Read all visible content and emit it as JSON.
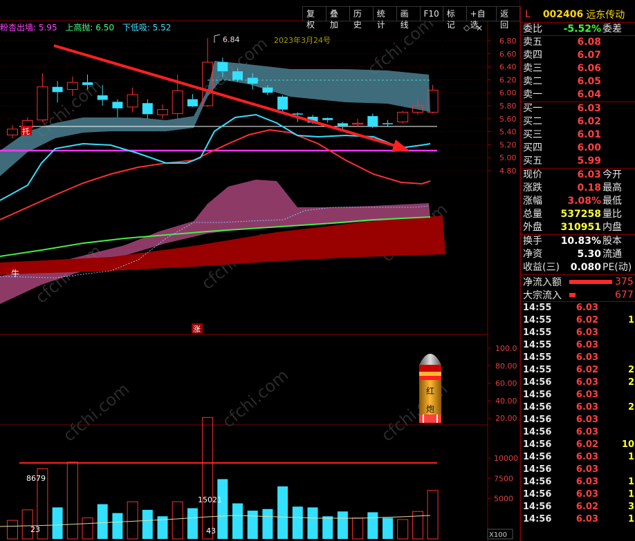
{
  "toolbar": {
    "buttons": [
      "复权",
      "叠加",
      "历史",
      "统计",
      "画线",
      "F10",
      "标记",
      "+自选",
      "返回"
    ]
  },
  "indicator_line": {
    "prefix": "粉杏出墙: 5.95",
    "up_label": "上高抛: 6.50",
    "down_label": "下低吸: 5.52"
  },
  "chart_labels": {
    "date_annotation": "2023年3月24号",
    "high_marker": "6.84",
    "tuo_badge": "托",
    "niu_label": "牛",
    "zhang_badge": "涨",
    "red_cannon_top": "红",
    "red_cannon_bottom": "炮",
    "vol_label_left": "8679",
    "vol_label_mid": "15021",
    "vol_label_low1": "23",
    "vol_label_low2": "43",
    "x100": "X100",
    "watermark": "cfchi.com"
  },
  "price_axis": [
    "6.80",
    "6.60",
    "6.40",
    "6.20",
    "6.00",
    "5.80",
    "5.60",
    "5.40",
    "5.20",
    "5.00",
    "4.80"
  ],
  "osc_axis": [
    "100.0",
    "80.00",
    "60.00",
    "40.00",
    "20.00"
  ],
  "vol_axis": [
    "10000",
    "7500",
    "5000"
  ],
  "stock": {
    "market": "L",
    "code": "002406",
    "name": "远东传动"
  },
  "order_ratio": {
    "label": "委比",
    "value": "-5.52%",
    "label2": "委差"
  },
  "asks": [
    {
      "label": "卖五",
      "price": "6.08"
    },
    {
      "label": "卖四",
      "price": "6.07"
    },
    {
      "label": "卖三",
      "price": "6.06"
    },
    {
      "label": "卖二",
      "price": "6.05"
    },
    {
      "label": "卖一",
      "price": "6.04"
    }
  ],
  "bids": [
    {
      "label": "买一",
      "price": "6.03"
    },
    {
      "label": "买二",
      "price": "6.02"
    },
    {
      "label": "买三",
      "price": "6.01"
    },
    {
      "label": "买四",
      "price": "6.00"
    },
    {
      "label": "买五",
      "price": "5.99"
    }
  ],
  "quote": [
    {
      "label": "现价",
      "value": "6.03",
      "label2": "今开",
      "color": "red"
    },
    {
      "label": "涨跌",
      "value": "0.18",
      "label2": "最高",
      "color": "red"
    },
    {
      "label": "涨幅",
      "value": "3.08%",
      "label2": "最低",
      "color": "red"
    },
    {
      "label": "总量",
      "value": "537258",
      "label2": "量比",
      "color": "yellow"
    },
    {
      "label": "外盘",
      "value": "310951",
      "label2": "内盘",
      "color": "yellow"
    }
  ],
  "fundamentals": [
    {
      "label": "换手",
      "value": "10.83%",
      "label2": "股本"
    },
    {
      "label": "净资",
      "value": "5.30",
      "label2": "流通"
    },
    {
      "label": "收益(三)",
      "value": "0.080",
      "label2": "PE(动)"
    }
  ],
  "flows": [
    {
      "label": "净流入额",
      "bar": 1.0,
      "value": "375"
    },
    {
      "label": "大宗流入",
      "bar": 0.15,
      "value": "677"
    }
  ],
  "ticks": [
    {
      "time": "14:55",
      "price": "6.03",
      "vol": "",
      "color": "red"
    },
    {
      "time": "14:55",
      "price": "6.02",
      "vol": "1",
      "color": "red"
    },
    {
      "time": "14:55",
      "price": "6.03",
      "vol": "",
      "color": "red"
    },
    {
      "time": "14:55",
      "price": "6.03",
      "vol": "",
      "color": "red"
    },
    {
      "time": "14:55",
      "price": "6.03",
      "vol": "",
      "color": "red"
    },
    {
      "time": "14:55",
      "price": "6.02",
      "vol": "2",
      "color": "red"
    },
    {
      "time": "14:56",
      "price": "6.03",
      "vol": "2",
      "color": "red"
    },
    {
      "time": "14:56",
      "price": "6.03",
      "vol": "",
      "color": "red"
    },
    {
      "time": "14:56",
      "price": "6.03",
      "vol": "2",
      "color": "red"
    },
    {
      "time": "14:56",
      "price": "6.03",
      "vol": "",
      "color": "red"
    },
    {
      "time": "14:56",
      "price": "6.03",
      "vol": "",
      "color": "red"
    },
    {
      "time": "14:56",
      "price": "6.02",
      "vol": "10",
      "color": "red"
    },
    {
      "time": "14:56",
      "price": "6.03",
      "vol": "1",
      "color": "red"
    },
    {
      "time": "14:56",
      "price": "6.03",
      "vol": "",
      "color": "red"
    },
    {
      "time": "14:56",
      "price": "6.03",
      "vol": "1",
      "color": "red"
    },
    {
      "time": "14:56",
      "price": "6.03",
      "vol": "1",
      "color": "red"
    },
    {
      "time": "14:56",
      "price": "6.02",
      "vol": "3",
      "color": "red"
    },
    {
      "time": "14:56",
      "price": "6.03",
      "vol": "1",
      "color": "red"
    }
  ],
  "chart_data": {
    "type": "candlestick",
    "ylim": [
      4.7,
      6.9
    ],
    "candles": [
      {
        "o": 5.35,
        "c": 5.44,
        "h": 5.5,
        "l": 5.3
      },
      {
        "o": 5.46,
        "c": 5.57,
        "h": 5.62,
        "l": 5.4
      },
      {
        "o": 5.58,
        "c": 6.09,
        "h": 6.3,
        "l": 5.55
      },
      {
        "o": 6.09,
        "c": 6.01,
        "h": 6.18,
        "l": 5.85
      },
      {
        "o": 6.05,
        "c": 6.16,
        "h": 6.25,
        "l": 5.95
      },
      {
        "o": 6.16,
        "c": 6.12,
        "h": 6.28,
        "l": 6.05
      },
      {
        "o": 5.96,
        "c": 5.89,
        "h": 6.12,
        "l": 5.8
      },
      {
        "o": 5.86,
        "c": 5.76,
        "h": 5.9,
        "l": 5.62
      },
      {
        "o": 5.78,
        "c": 5.97,
        "h": 6.08,
        "l": 5.7
      },
      {
        "o": 5.84,
        "c": 5.67,
        "h": 5.9,
        "l": 5.6
      },
      {
        "o": 5.66,
        "c": 5.74,
        "h": 5.82,
        "l": 5.6
      },
      {
        "o": 5.68,
        "c": 6.03,
        "h": 6.28,
        "l": 5.6
      },
      {
        "o": 5.9,
        "c": 5.79,
        "h": 5.98,
        "l": 5.78
      },
      {
        "o": 5.8,
        "c": 6.47,
        "h": 6.84,
        "l": 5.78
      },
      {
        "o": 6.47,
        "c": 6.33,
        "h": 6.54,
        "l": 6.24
      },
      {
        "o": 6.33,
        "c": 6.2,
        "h": 6.38,
        "l": 6.17
      },
      {
        "o": 6.23,
        "c": 6.14,
        "h": 6.3,
        "l": 6.05
      },
      {
        "o": 6.08,
        "c": 6.0,
        "h": 6.12,
        "l": 5.96
      },
      {
        "o": 5.94,
        "c": 5.74,
        "h": 5.96,
        "l": 5.7
      },
      {
        "o": 5.68,
        "c": 5.67,
        "h": 5.7,
        "l": 5.55
      },
      {
        "o": 5.63,
        "c": 5.54,
        "h": 5.66,
        "l": 5.52
      },
      {
        "o": 5.61,
        "c": 5.58,
        "h": 5.62,
        "l": 5.54
      },
      {
        "o": 5.53,
        "c": 5.49,
        "h": 5.55,
        "l": 5.44
      },
      {
        "o": 5.52,
        "c": 5.53,
        "h": 5.6,
        "l": 5.48
      },
      {
        "o": 5.64,
        "c": 5.48,
        "h": 5.68,
        "l": 5.46
      },
      {
        "o": 5.53,
        "c": 5.52,
        "h": 5.58,
        "l": 5.47
      },
      {
        "o": 5.55,
        "c": 5.7,
        "h": 5.72,
        "l": 5.53
      },
      {
        "o": 5.7,
        "c": 5.8,
        "h": 5.9,
        "l": 5.66
      },
      {
        "o": 5.7,
        "c": 6.04,
        "h": 6.12,
        "l": 5.68
      }
    ],
    "volumes": [
      {
        "v": 2300,
        "up": true
      },
      {
        "v": 3600,
        "up": true
      },
      {
        "v": 8679,
        "up": true
      },
      {
        "v": 3900,
        "up": false
      },
      {
        "v": 9500,
        "up": true
      },
      {
        "v": 2600,
        "up": true
      },
      {
        "v": 4300,
        "up": false
      },
      {
        "v": 3200,
        "up": false
      },
      {
        "v": 4600,
        "up": true
      },
      {
        "v": 3600,
        "up": false
      },
      {
        "v": 2800,
        "up": false
      },
      {
        "v": 4600,
        "up": true
      },
      {
        "v": 3800,
        "up": false
      },
      {
        "v": 15021,
        "up": true
      },
      {
        "v": 7400,
        "up": false
      },
      {
        "v": 4400,
        "up": false
      },
      {
        "v": 3500,
        "up": false
      },
      {
        "v": 3700,
        "up": false
      },
      {
        "v": 6500,
        "up": false
      },
      {
        "v": 4000,
        "up": false
      },
      {
        "v": 3900,
        "up": false
      },
      {
        "v": 2800,
        "up": false
      },
      {
        "v": 3400,
        "up": false
      },
      {
        "v": 2600,
        "up": true
      },
      {
        "v": 3300,
        "up": false
      },
      {
        "v": 2600,
        "up": false
      },
      {
        "v": 2400,
        "up": true
      },
      {
        "v": 3400,
        "up": true
      },
      {
        "v": 6000,
        "up": true
      }
    ]
  }
}
